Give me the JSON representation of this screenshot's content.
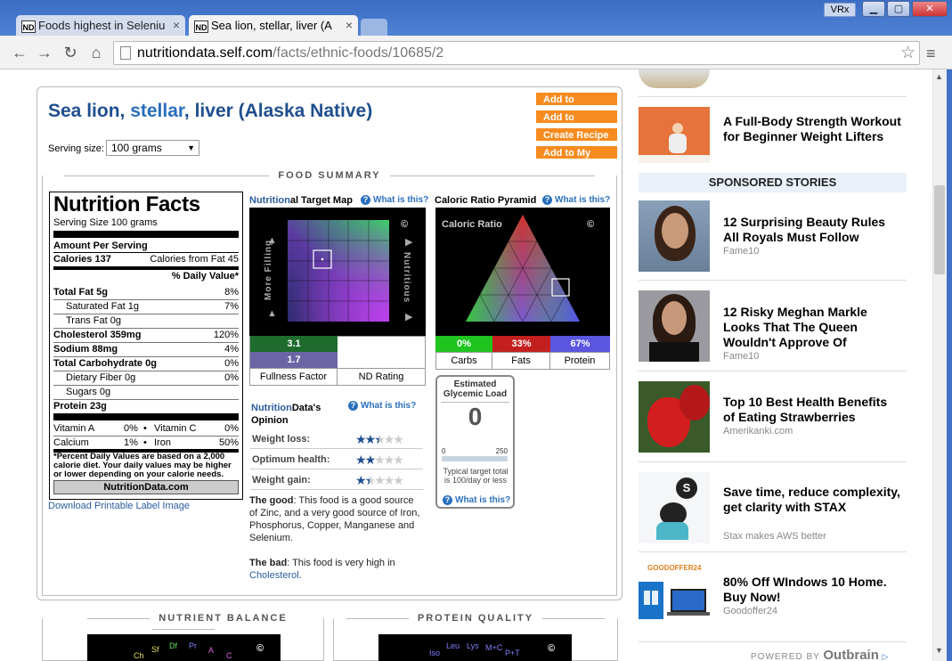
{
  "browser": {
    "tabs": [
      {
        "favicon": "ND",
        "title": "Foods highest in Seleniu"
      },
      {
        "favicon": "ND",
        "title": "Sea lion, stellar, liver (A"
      }
    ],
    "profile": "VRx",
    "url_host": "nutritiondata.self.com",
    "url_path": "/facts/ethnic-foods/10685/2",
    "window_buttons": {
      "minimize": "▁",
      "maximize": "▢",
      "close": "✕"
    }
  },
  "food": {
    "title_p1": "Sea lion",
    "title_sep1": ", ",
    "title_p2": "stellar",
    "title_sep2": ", ",
    "title_p3": "liver",
    "title_p4": " (Alaska Native)",
    "serving_label": "Serving size:",
    "serving_value": "100 grams",
    "actions": [
      "Add to Tracking",
      "Add to Compare",
      "Create Recipe",
      "Add to My"
    ]
  },
  "summary_heading": "FOOD SUMMARY",
  "nutrition_facts": {
    "heading": "Nutrition Facts",
    "serving_size": "Serving Size  100 grams",
    "amount_per": "Amount Per Serving",
    "calories": "Calories 137",
    "calories_fat": "Calories from Fat 45",
    "dv_header": "% Daily Value*",
    "rows": [
      {
        "label": "Total Fat 5g",
        "dv": "8%",
        "bold": true,
        "indent": false
      },
      {
        "label": "Saturated Fat 1g",
        "dv": "7%",
        "bold": false,
        "indent": true
      },
      {
        "label": "Trans Fat 0g",
        "dv": "",
        "bold": false,
        "indent": true
      },
      {
        "label": "Cholesterol 359mg",
        "dv": "120%",
        "bold": true,
        "indent": false
      },
      {
        "label": "Sodium 88mg",
        "dv": "4%",
        "bold": true,
        "indent": false
      },
      {
        "label": "Total Carbohydrate 0g",
        "dv": "0%",
        "bold": true,
        "indent": false
      },
      {
        "label": "Dietary Fiber 0g",
        "dv": "0%",
        "bold": false,
        "indent": true
      },
      {
        "label": "Sugars 0g",
        "dv": "",
        "bold": false,
        "indent": true
      },
      {
        "label": "Protein 23g",
        "dv": "",
        "bold": true,
        "indent": false
      }
    ],
    "vitamins": [
      {
        "left": "Vitamin A",
        "left_pct": "0%",
        "right": "Vitamin C",
        "right_pct": "0%"
      },
      {
        "left": "Calcium",
        "left_pct": "1%",
        "right": "Iron",
        "right_pct": "50%"
      }
    ],
    "footnote": "*Percent Daily Values are based on a 2,000 calorie diet. Your daily values may be higher or lower depending on your calorie needs.",
    "brand": "NutritionData.com",
    "download": "Download Printable Label Image"
  },
  "target_map": {
    "title_b": "Nutrition",
    "title_rest": "al Target Map",
    "what": "What is this?",
    "copyright": "©",
    "left_axis": "More Filling",
    "right_axis": "Nutritious",
    "fullness": "3.1",
    "nd_rating": "1.7",
    "fullness_label": "Fullness Factor",
    "nd_label": "ND Rating"
  },
  "caloric": {
    "title": "Caloric Ratio Pyramid",
    "what": "What is this?",
    "inner": "Caloric Ratio",
    "copyright": "©",
    "carbs": "0%",
    "fats": "33%",
    "protein": "67%",
    "carbs_label": "Carbs",
    "fats_label": "Fats",
    "protein_label": "Protein",
    "colors": {
      "carbs": "#1fc41f",
      "fats": "#c41f1f",
      "protein": "#5a56e0"
    }
  },
  "glycemic": {
    "title": "Estimated Glycemic Load",
    "value": "0",
    "min": "0",
    "max": "250",
    "note": "Typical target total is 100/day or less",
    "what": "What is this?"
  },
  "opinion": {
    "title_b": "Nutrition",
    "title_rest": "Data's Opinion",
    "what": "What is this?",
    "rows": [
      {
        "label": "Weight loss:",
        "stars": 2.5
      },
      {
        "label": "Optimum health:",
        "stars": 2
      },
      {
        "label": "Weight gain:",
        "stars": 1.5
      }
    ],
    "good_label": "The good",
    "good_text": ": This food is a good source of Zinc, and a very good source of Iron, Phosphorus, Copper, Manganese and Selenium.",
    "bad_label": "The bad",
    "bad_text": ": This food is very high in ",
    "bad_link": "Cholesterol",
    "bad_end": "."
  },
  "sections": {
    "nutrient_balance": "NUTRIENT BALANCE",
    "protein_quality": "PROTEIN QUALITY"
  },
  "nb_labels": [
    "Sf",
    "Df",
    "Pr",
    "A",
    "Ch",
    "C"
  ],
  "pq_labels": [
    "Leu",
    "Lys",
    "M+C",
    "Iso",
    "P+T"
  ],
  "sidebar": {
    "sponsored": "SPONSORED STORIES",
    "stories": [
      {
        "title": "A Full-Body Strength Workout for Beginner Weight Lifters",
        "source": ""
      },
      {
        "title": "12 Surprising Beauty Rules All Royals Must Follow",
        "source": "Fame10"
      },
      {
        "title": "12 Risky Meghan Markle Looks That The Queen Wouldn't Approve Of",
        "source": "Fame10"
      },
      {
        "title": "Top 10 Best Health Benefits of Eating Strawberries",
        "source": "Amerikanki.com"
      },
      {
        "title": "Save time, reduce complexity, get clarity with STAX",
        "source": "Stax makes AWS better"
      },
      {
        "title": "80% Off WIndows 10 Home. Buy Now!",
        "source": "Goodoffer24"
      }
    ],
    "thumb_text": "GOODOFFER24",
    "powered_by": "POWERED BY",
    "outbrain": "Outbrain"
  }
}
